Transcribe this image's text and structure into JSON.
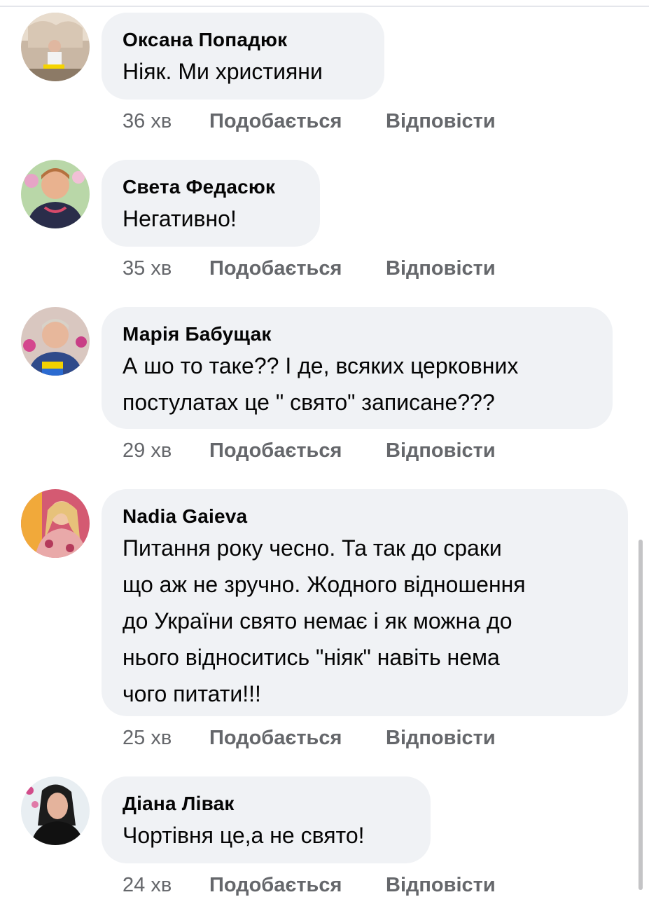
{
  "comments": [
    {
      "author": "Оксана Попадюк",
      "text": "Ніяк. Ми християни",
      "time": "36 хв",
      "like_label": "Подобається",
      "reply_label": "Відповісти"
    },
    {
      "author": "Света Федасюк",
      "text": "Негативно!",
      "time": "35 хв",
      "like_label": "Подобається",
      "reply_label": "Відповісти"
    },
    {
      "author": "Марія Бабущак",
      "text": "А шо то таке?? І де, всяких церковних\nпостулатах це \" свято\" записане???",
      "time": "29 хв",
      "like_label": "Подобається",
      "reply_label": "Відповісти"
    },
    {
      "author": "Nadia Gaieva",
      "text": "Питання року чесно. Та так до сраки\nщо аж не зручно. Жодного відношення\nдо України свято немає і як можна до\nнього відноситись \"ніяк\" навіть нема\nчого питати!!!",
      "time": "25 хв",
      "like_label": "Подобається",
      "reply_label": "Відповісти"
    },
    {
      "author": "Діана Лівак",
      "text": "Чортівня це,а не свято!",
      "time": "24 хв",
      "like_label": "Подобається",
      "reply_label": "Відповісти"
    }
  ]
}
